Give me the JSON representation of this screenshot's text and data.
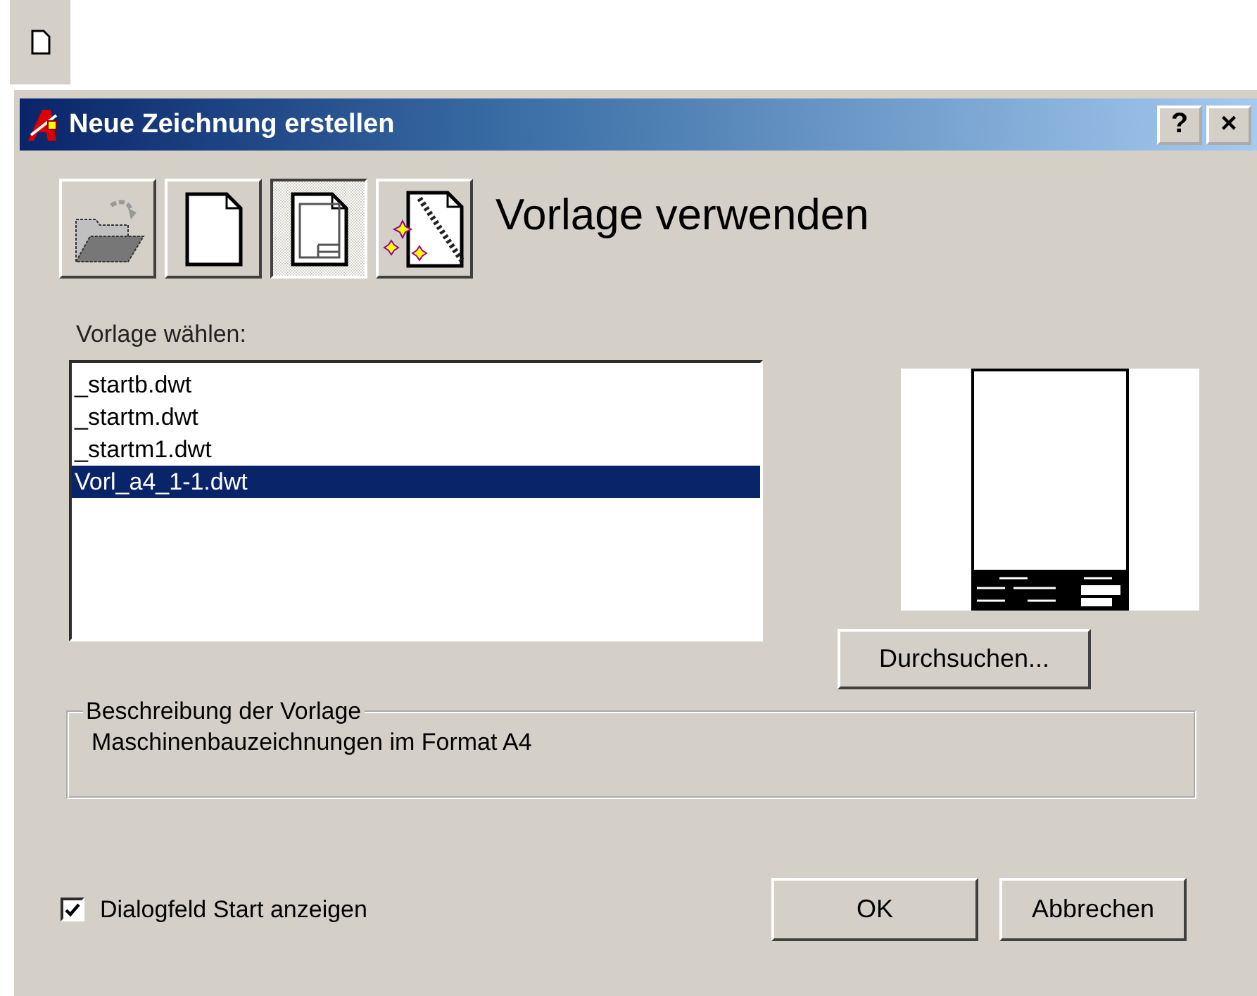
{
  "window": {
    "title": "Neue Zeichnung erstellen",
    "title_buttons": [
      "?",
      "×"
    ]
  },
  "modes": [
    {
      "kind": "open",
      "selected": false
    },
    {
      "kind": "blank",
      "selected": false
    },
    {
      "kind": "template",
      "selected": true
    },
    {
      "kind": "wizard",
      "selected": false
    }
  ],
  "heading": "Vorlage verwenden",
  "template_list": {
    "label": "Vorlage wählen:",
    "items": [
      {
        "name": "_startb.dwt",
        "selected": false
      },
      {
        "name": "_startm.dwt",
        "selected": false
      },
      {
        "name": "_startm1.dwt",
        "selected": false
      },
      {
        "name": "Vorl_a4_1-1.dwt",
        "selected": true
      }
    ]
  },
  "browse_button": "Durchsuchen...",
  "description": {
    "legend": "Beschreibung der Vorlage",
    "text": "Maschinenbauzeichnungen im Format A4"
  },
  "show_start_dialog": {
    "label": "Dialogfeld Start anzeigen",
    "checked": true
  },
  "buttons": [
    "OK",
    "Abbrechen"
  ]
}
